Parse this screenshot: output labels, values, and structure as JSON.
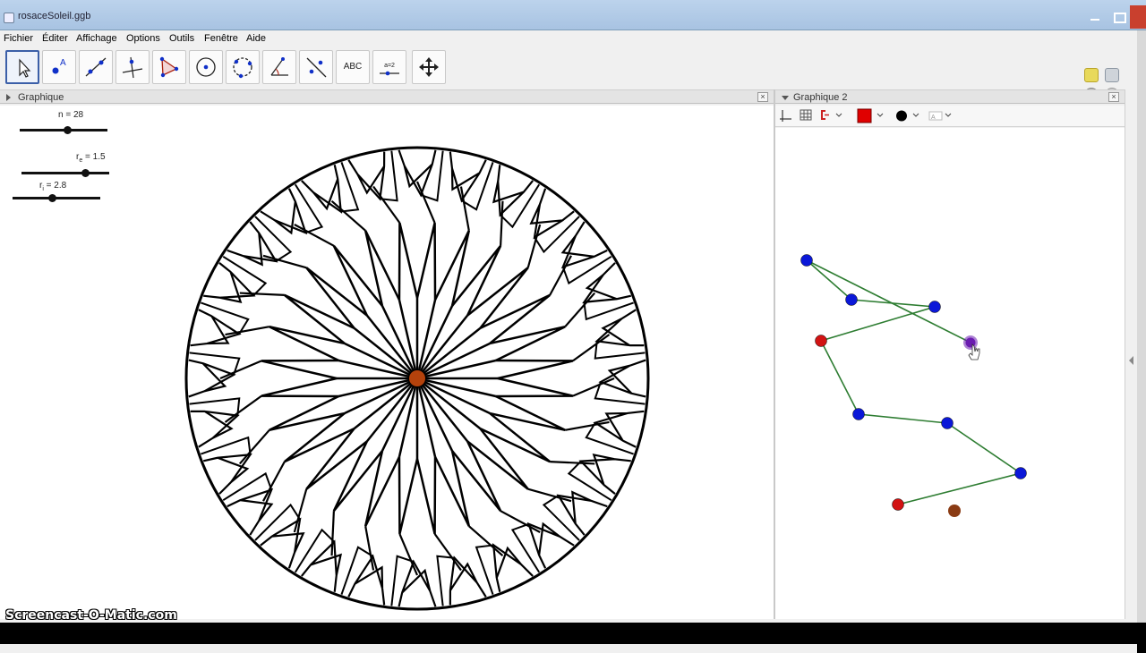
{
  "window": {
    "title": "rosaceSoleil.ggb"
  },
  "menu": [
    "Fichier",
    "Éditer",
    "Affichage",
    "Options",
    "Outils",
    "Fenêtre",
    "Aide"
  ],
  "toolbar": {
    "tools": [
      {
        "name": "move-tool-button",
        "icon": "arrow-cursor-icon"
      },
      {
        "name": "point-tool-button",
        "icon": "point-A-icon",
        "label": "A"
      },
      {
        "name": "line-tool-button",
        "icon": "line-icon"
      },
      {
        "name": "perpendicular-tool-button",
        "icon": "perpendicular-icon"
      },
      {
        "name": "polygon-tool-button",
        "icon": "polygon-icon"
      },
      {
        "name": "circle-tool-button",
        "icon": "circle-center-icon"
      },
      {
        "name": "circle-3points-tool-button",
        "icon": "circle-points-icon"
      },
      {
        "name": "angle-tool-button",
        "icon": "angle-icon"
      },
      {
        "name": "reflect-tool-button",
        "icon": "reflect-icon"
      },
      {
        "name": "text-tool-button",
        "icon": "text-icon",
        "label": "ABC"
      },
      {
        "name": "slider-tool-button",
        "icon": "slider-icon",
        "label": "a=2"
      },
      {
        "name": "move-view-tool-button",
        "icon": "move-view-icon"
      }
    ]
  },
  "graphics1": {
    "title": "Graphique",
    "sliders": [
      {
        "label": "n = 28",
        "value": 28
      },
      {
        "label_main": "r",
        "label_sub": "e",
        "label_rest": " = 1.5",
        "value": 1.5
      },
      {
        "label_main": "r",
        "label_sub": "i",
        "label_rest": " = 2.8",
        "value": 2.8
      }
    ]
  },
  "graphics2": {
    "title": "Graphique 2",
    "style_colors": {
      "fill": "#e00000",
      "point": "#000000"
    },
    "line_color": "#2e7d32"
  },
  "watermark": "Screencast-O-Matic.com",
  "colors": {
    "blue_point": "#0b18d8",
    "red_point": "#d21313",
    "brown_point": "#8a3b14",
    "center_point": "#b4420c",
    "highlight_point": "#6a1bb0"
  }
}
